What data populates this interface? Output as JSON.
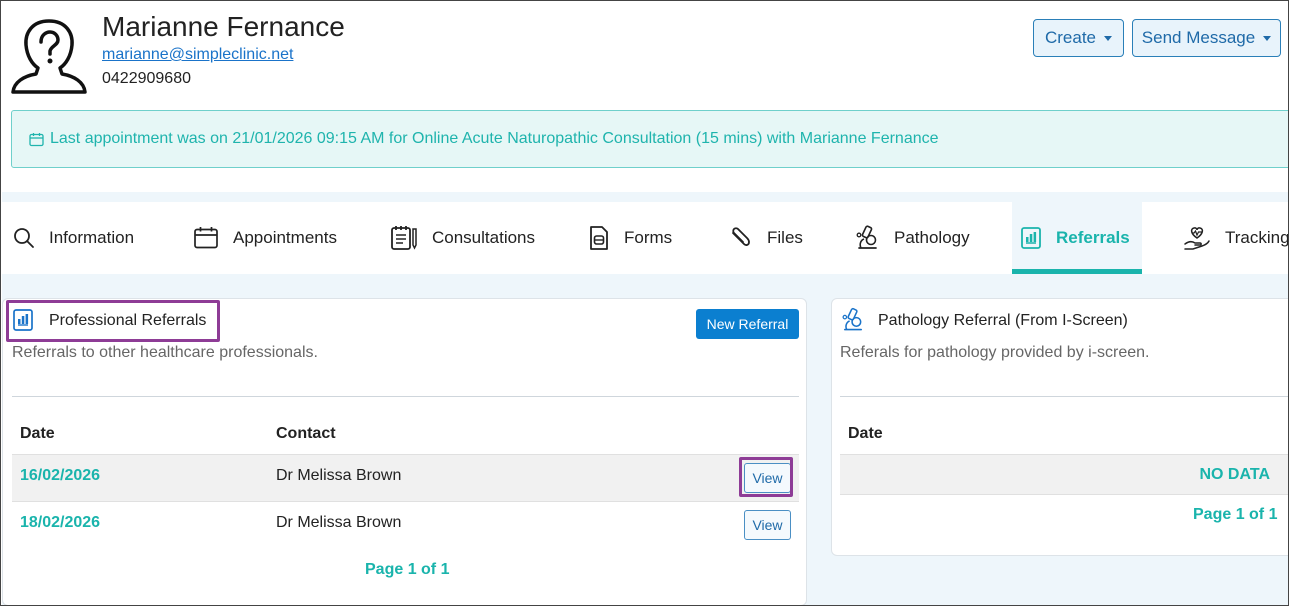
{
  "header": {
    "name": "Marianne Fernance",
    "email": "marianne@simpleclinic.net",
    "phone": "0422909680",
    "create_label": "Create",
    "send_message_label": "Send Message"
  },
  "alert": {
    "text": "Last appointment was on 21/01/2026 09:15 AM for Online Acute Naturopathic Consultation (15 mins) with Marianne Fernance"
  },
  "tabs": [
    {
      "label": "Information",
      "icon": "search-icon"
    },
    {
      "label": "Appointments",
      "icon": "calendar-icon"
    },
    {
      "label": "Consultations",
      "icon": "notepad-icon"
    },
    {
      "label": "Forms",
      "icon": "document-icon"
    },
    {
      "label": "Files",
      "icon": "paperclip-icon"
    },
    {
      "label": "Pathology",
      "icon": "microscope-icon"
    },
    {
      "label": "Referrals",
      "icon": "chart-doc-icon",
      "active": true
    },
    {
      "label": "Tracking",
      "icon": "heart-hand-icon"
    }
  ],
  "professional": {
    "title": "Professional Referrals",
    "subtitle": "Referrals to other healthcare professionals.",
    "new_label": "New Referral",
    "col_date": "Date",
    "col_contact": "Contact",
    "rows": [
      {
        "date": "16/02/2026",
        "contact": "Dr Melissa Brown",
        "action": "View"
      },
      {
        "date": "18/02/2026",
        "contact": "Dr Melissa Brown",
        "action": "View"
      }
    ],
    "pager": "Page 1 of 1"
  },
  "pathology": {
    "title": "Pathology Referral (From I-Screen)",
    "subtitle": "Referals for pathology provided by i-screen.",
    "col_date": "Date",
    "empty": "NO DATA",
    "pager": "Page 1 of 1"
  },
  "colors": {
    "teal": "#1ab4ac",
    "blue": "#0b7fd0",
    "highlight": "#8e3c96"
  }
}
